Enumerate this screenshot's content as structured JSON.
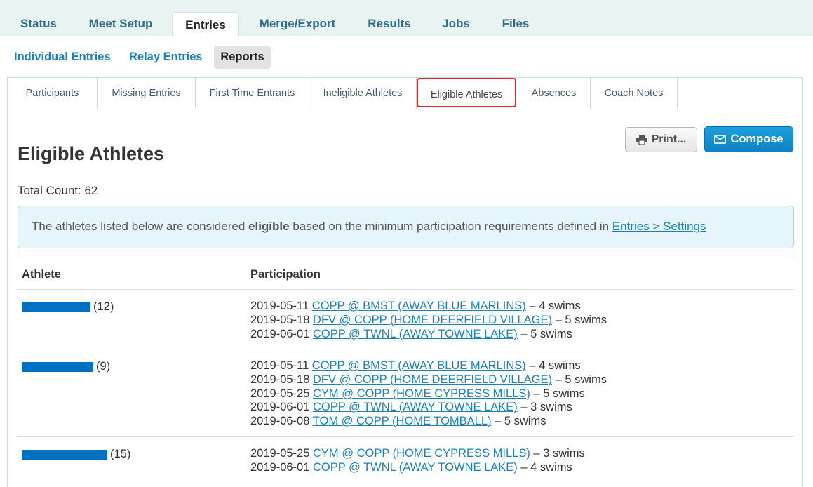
{
  "top_tabs": [
    "Status",
    "Meet Setup",
    "Entries",
    "Merge/Export",
    "Results",
    "Jobs",
    "Files"
  ],
  "sub_tabs": [
    "Individual Entries",
    "Relay Entries",
    "Reports"
  ],
  "report_tabs": [
    "Participants",
    "Missing Entries",
    "First Time Entrants",
    "Ineligible Athletes",
    "Eligible Athletes",
    "Absences",
    "Coach Notes"
  ],
  "actions": {
    "print_label": "Print...",
    "compose_label": "Compose"
  },
  "page": {
    "title": "Eligible Athletes",
    "total_count": "Total Count: 62",
    "info_text_before": "The athletes listed below are considered ",
    "info_text_bold": "eligible",
    "info_text_after": " based on the minimum participation requirements defined in ",
    "info_link": "Entries > Settings"
  },
  "table": {
    "headers": {
      "athlete": "Athlete",
      "participation": "Participation"
    },
    "rows": [
      {
        "count": "(12)",
        "entries": [
          {
            "date": "2019-05-11",
            "meet": "COPP @ BMST (AWAY BLUE MARLINS)",
            "swims": " – 4 swims"
          },
          {
            "date": "2019-05-18",
            "meet": "DFV @ COPP (HOME DEERFIELD VILLAGE)",
            "swims": " – 5 swims"
          },
          {
            "date": "2019-06-01",
            "meet": "COPP @ TWNL (AWAY TOWNE LAKE)",
            "swims": " – 5 swims"
          }
        ]
      },
      {
        "count": "(9)",
        "entries": [
          {
            "date": "2019-05-11",
            "meet": "COPP @ BMST (AWAY BLUE MARLINS)",
            "swims": " – 4 swims"
          },
          {
            "date": "2019-05-18",
            "meet": "DFV @ COPP (HOME DEERFIELD VILLAGE)",
            "swims": " – 5 swims"
          },
          {
            "date": "2019-05-25",
            "meet": "CYM @ COPP (HOME CYPRESS MILLS)",
            "swims": " – 5 swims"
          },
          {
            "date": "2019-06-01",
            "meet": "COPP @ TWNL (AWAY TOWNE LAKE)",
            "swims": " – 3 swims"
          },
          {
            "date": "2019-06-08",
            "meet": "TOM @ COPP (HOME TOMBALL)",
            "swims": " – 5 swims"
          }
        ]
      },
      {
        "count": "(15)",
        "entries": [
          {
            "date": "2019-05-25",
            "meet": "CYM @ COPP (HOME CYPRESS MILLS)",
            "swims": " – 3 swims"
          },
          {
            "date": "2019-06-01",
            "meet": "COPP @ TWNL (AWAY TOWNE LAKE)",
            "swims": " – 4 swims"
          }
        ]
      }
    ]
  },
  "colors": {
    "link": "#1a82b8",
    "highlight": "#e02a2a",
    "compose": "#1aa0de",
    "redaction": "#0070c0"
  },
  "icons": {
    "print": "printer-icon",
    "compose": "envelope-icon"
  }
}
